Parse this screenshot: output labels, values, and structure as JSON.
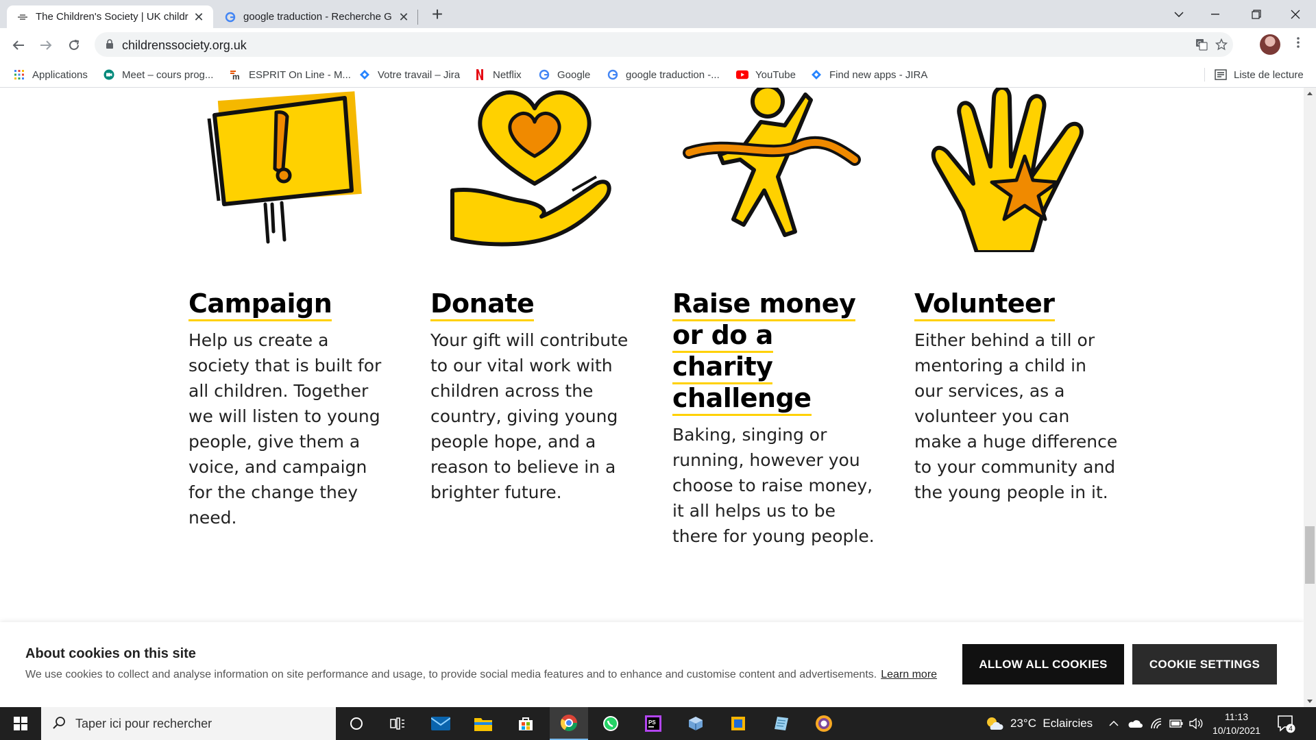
{
  "browser": {
    "tabs": [
      {
        "title": "The Children's Society | UK childr",
        "close": "✕"
      },
      {
        "title": "google traduction - Recherche G",
        "close": "✕"
      }
    ],
    "new_tab": "+",
    "url": "childrenssociety.org.uk",
    "bookmarks": [
      {
        "label": "Applications",
        "icon": "apps-grid-icon"
      },
      {
        "label": "Meet – cours prog...",
        "icon": "meet-icon"
      },
      {
        "label": "ESPRIT On Line - M...",
        "icon": "esprit-icon"
      },
      {
        "label": "Votre travail – Jira",
        "icon": "jira-icon"
      },
      {
        "label": "Netflix",
        "icon": "netflix-icon"
      },
      {
        "label": "Google",
        "icon": "google-icon"
      },
      {
        "label": "google traduction -...",
        "icon": "google-icon"
      },
      {
        "label": "YouTube",
        "icon": "youtube-icon"
      },
      {
        "label": "Find new apps - JIRA",
        "icon": "jira-icon"
      }
    ],
    "reading_list": "Liste de lecture"
  },
  "cards": [
    {
      "title": "Campaign",
      "text": "Help us create a society that is built for all children. Together we will listen to young people, give them a voice, and campaign for the change they need.",
      "icon": "campaign-sign-icon"
    },
    {
      "title": "Donate",
      "text": "Your gift will contribute to our vital work with children across the country, giving young people hope, and a reason to believe in a brighter future.",
      "icon": "heart-hand-icon"
    },
    {
      "title": "Raise money or do a charity challenge",
      "text": "Baking, singing or running, however you choose to raise money, it all helps us to be there for young people.",
      "icon": "runner-icon"
    },
    {
      "title": "Volunteer",
      "text": "Either behind a till or mentoring a child in our services, as a volunteer you can make a huge difference to your community and the young people in it.",
      "icon": "hand-star-icon"
    }
  ],
  "cookie": {
    "title": "About cookies on this site",
    "text": "We use cookies to collect and analyse information on site performance and usage, to provide social media features and to enhance and customise content and advertisements.",
    "learn_more": "Learn more",
    "allow_all": "ALLOW ALL COOKIES",
    "settings": "COOKIE SETTINGS"
  },
  "taskbar": {
    "search_placeholder": "Taper ici pour rechercher",
    "weather": "23°C  Eclaircies",
    "time": "11:13",
    "date": "10/10/2021",
    "notifications": "4"
  },
  "colors": {
    "brand_yellow": "#ffd100",
    "orange": "#f08a00",
    "button_dark": "#111111"
  }
}
